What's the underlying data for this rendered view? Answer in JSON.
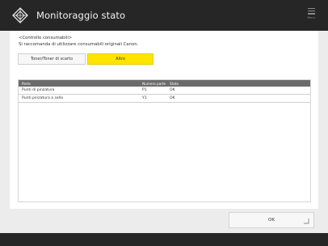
{
  "header": {
    "title": "Monitoraggio stato",
    "menu_label": "Menu",
    "logo_icon": "diamond-grid-icon",
    "menu_icon": "hamburger-menu-icon"
  },
  "notice": {
    "line1": "<Controllo consumabili>",
    "line2": "Si raccomanda di utilizzare consumabili originali Canon."
  },
  "tabs": [
    {
      "label": "Toner/Toner di scarto",
      "selected": false
    },
    {
      "label": "Altro",
      "selected": true
    }
  ],
  "table": {
    "headers": {
      "part": "Parte",
      "part_number": "Numero parte",
      "status": "Stato"
    },
    "rows": [
      {
        "part": "Punti di pinzatura",
        "part_number": "P1",
        "status": "OK"
      },
      {
        "part": "Punti pinzatura a sella",
        "part_number": "Y1",
        "status": "OK"
      }
    ]
  },
  "ok_button": {
    "label": "OK"
  },
  "colors": {
    "header_bg": "#262626",
    "accent_yellow": "#ffe400",
    "table_header_bg": "#6b6b6b"
  }
}
